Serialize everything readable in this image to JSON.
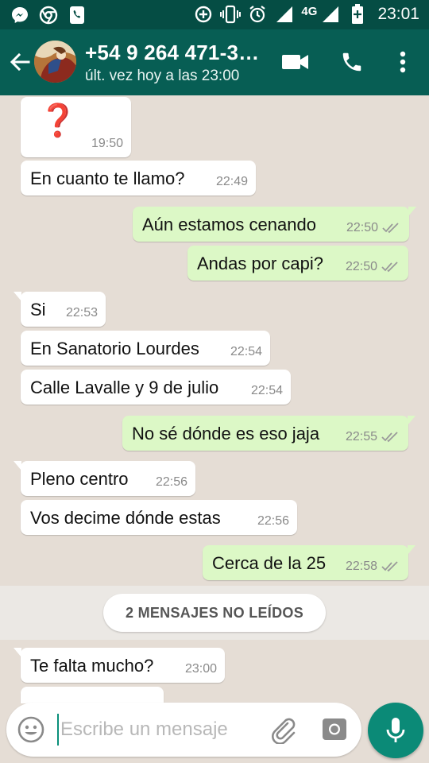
{
  "status_bar": {
    "network_label": "4G",
    "time": "23:01",
    "icons": [
      "messenger-icon",
      "chrome-icon",
      "phone-app-icon",
      "data-saver-icon",
      "vibrate-icon",
      "alarm-icon",
      "signal-icon",
      "battery-charging-icon"
    ]
  },
  "header": {
    "contact_name": "+54 9 264 471-3…",
    "last_seen": "últ. vez hoy a las 23:00",
    "actions": [
      "video-call-icon",
      "voice-call-icon",
      "more-vert-icon"
    ]
  },
  "messages": [
    {
      "direction": "in",
      "text": "❓",
      "time": "19:50"
    },
    {
      "direction": "in",
      "text": "En cuanto te llamo?",
      "time": "22:49"
    },
    {
      "direction": "out",
      "text": "Aún estamos cenando",
      "time": "22:50",
      "read": true
    },
    {
      "direction": "out",
      "text": "Andas por capi?",
      "time": "22:50",
      "read": true
    },
    {
      "direction": "in",
      "text": "Si",
      "time": "22:53"
    },
    {
      "direction": "in",
      "text": "En Sanatorio Lourdes",
      "time": "22:54"
    },
    {
      "direction": "in",
      "text": "Calle Lavalle y 9 de julio",
      "time": "22:54"
    },
    {
      "direction": "out",
      "text": "No sé dónde es eso jaja",
      "time": "22:55",
      "read": true
    },
    {
      "direction": "in",
      "text": "Pleno centro",
      "time": "22:56"
    },
    {
      "direction": "in",
      "text": "Vos decime dónde estas",
      "time": "22:56"
    },
    {
      "direction": "out",
      "text": "Cerca de la 25",
      "time": "22:58",
      "read": true
    },
    {
      "direction": "in",
      "text": "Te falta mucho?",
      "time": "23:00"
    }
  ],
  "unread_divider": "2 MENSAJES NO LEÍDOS",
  "composer": {
    "placeholder": "Escribe un mensaje"
  },
  "colors": {
    "status_bar": "#054d44",
    "app_bar": "#075e54",
    "chat_bg": "#e5ddd5",
    "outgoing_bubble": "#dcf8c6",
    "incoming_bubble": "#ffffff",
    "fab": "#0b8a77",
    "read_tick": "#8a8a8a"
  }
}
